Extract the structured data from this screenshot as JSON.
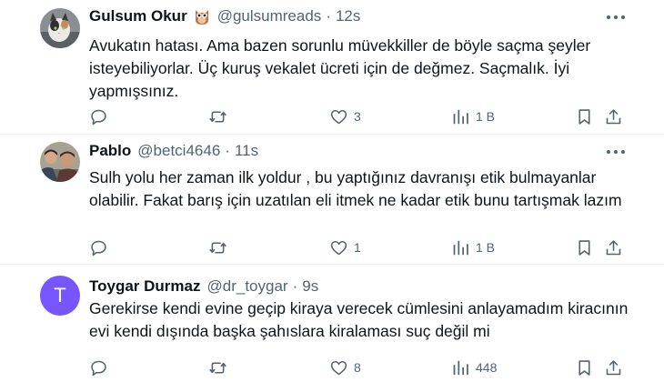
{
  "tweets": [
    {
      "name": "Gulsum Okur",
      "badge_icon": "owl-emoji",
      "handle": "@gulsumreads",
      "separator": "·",
      "time": "12s",
      "avatar_icon": "cat-photo-avatar",
      "text_lines": [
        "Avukatın hatası. Ama bazen sorunlu müvekkiller de böyle saçma şeyler",
        "isteyebiliyorlar. Üç kuruş vekalet ücreti için de değmez. Saçmalık. İyi",
        "yapmışsınız."
      ],
      "actions": {
        "reply": "",
        "retweet": "",
        "like": "3",
        "views": "1 B"
      }
    },
    {
      "name": "Pablo",
      "handle": "@betci4646",
      "separator": "·",
      "time": "11s",
      "avatar_icon": "group-photo-avatar",
      "text_lines": [
        "Sulh yolu her zaman ilk yoldur , bu yaptığınız davranışı etik bulmayanlar",
        "olabilir. Fakat barış için uzatılan eli itmek ne kadar etik bunu tartışmak lazım"
      ],
      "actions": {
        "reply": "",
        "retweet": "",
        "like": "1",
        "views": "1 B"
      }
    },
    {
      "name": "Toygar Durmaz",
      "handle": "@dr_toygar",
      "separator": "·",
      "time": "9s",
      "avatar_letter": "T",
      "avatar_color": "#7856ff",
      "text_lines": [
        "Gerekirse kendi evine geçip kiraya verecek cümlesini anlayamadım kiracının",
        "evi kendi dışında başka şahıslara kiralaması suç değil mi"
      ],
      "actions": {
        "reply": "",
        "retweet": "",
        "like": "8",
        "views": "448"
      }
    }
  ],
  "colors": {
    "text": "#0f1419",
    "muted": "#536471",
    "divider": "#eff3f4",
    "owl": "#c0704a"
  }
}
